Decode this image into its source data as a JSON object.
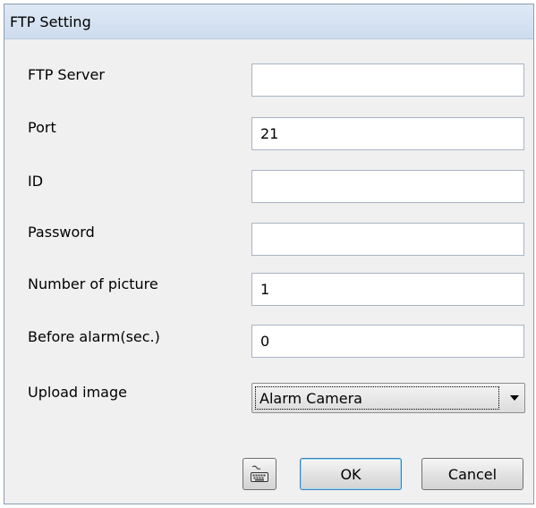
{
  "dialog": {
    "title": "FTP Setting"
  },
  "form": {
    "ftp_server": {
      "label": "FTP Server",
      "value": ""
    },
    "port": {
      "label": "Port",
      "value": "21"
    },
    "id": {
      "label": "ID",
      "value": ""
    },
    "password": {
      "label": "Password",
      "value": ""
    },
    "number_of_picture": {
      "label": "Number of picture",
      "value": "1"
    },
    "before_alarm": {
      "label": "Before alarm(sec.)",
      "value": "0"
    },
    "upload_image": {
      "label": "Upload image",
      "value": "Alarm Camera"
    }
  },
  "buttons": {
    "keyboard_icon": "keyboard-icon",
    "ok_label": "OK",
    "cancel_label": "Cancel"
  },
  "colors": {
    "titlebar": "#d6e3f2",
    "dialog_bg": "#f0f0f0",
    "ok_border": "#3c7fb1"
  }
}
